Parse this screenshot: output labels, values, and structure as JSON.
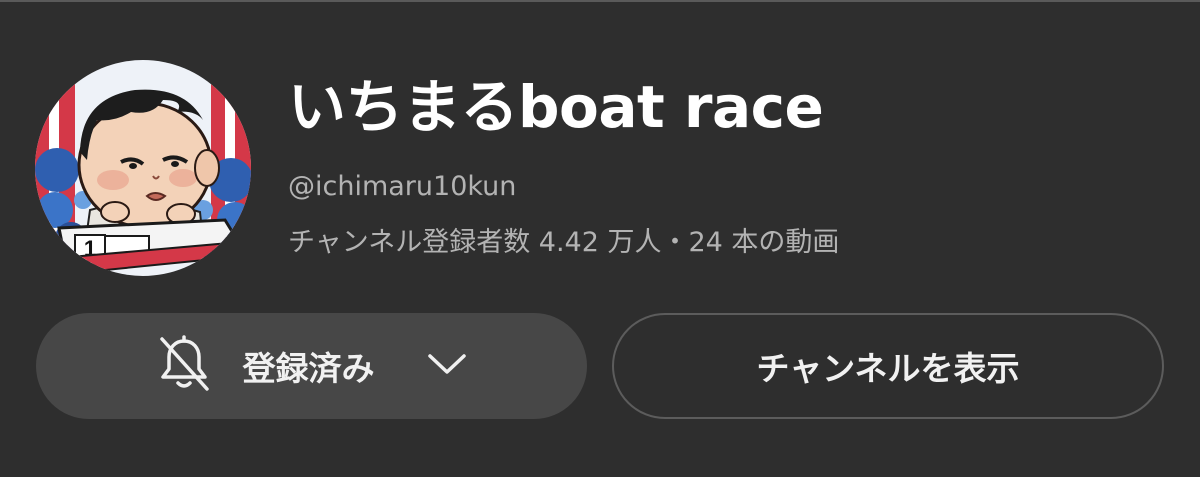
{
  "channel": {
    "name": "いちまるboat race",
    "handle": "@ichimaru10kun",
    "stats_line": "チャンネル登録者数 4.42 万人・24 本の動画",
    "avatar_badge": "1"
  },
  "buttons": {
    "subscribed_label": "登録済み",
    "view_channel_label": "チャンネルを表示"
  },
  "icons": {
    "bell": "bell-off-icon",
    "chevron": "chevron-down-icon"
  },
  "colors": {
    "background": "#2e2e2e",
    "primary_text": "#ffffff",
    "secondary_text": "#b3b3b3",
    "subscribed_button": "#474747",
    "outline_button_border": "#5c5c5c"
  }
}
